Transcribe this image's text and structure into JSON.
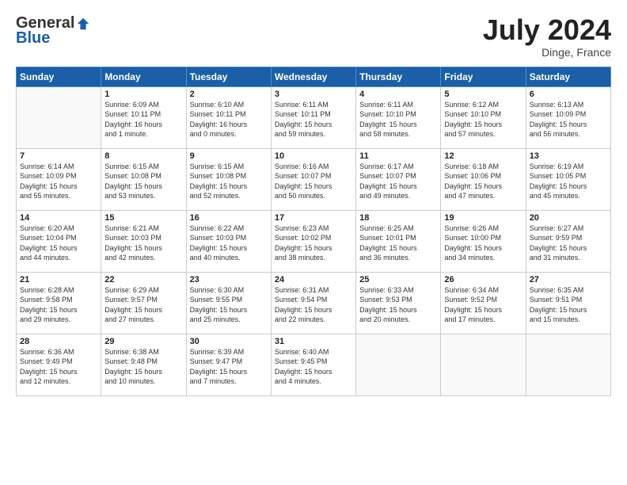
{
  "header": {
    "logo_general": "General",
    "logo_blue": "Blue",
    "month_title": "July 2024",
    "location": "Dinge, France"
  },
  "days_of_week": [
    "Sunday",
    "Monday",
    "Tuesday",
    "Wednesday",
    "Thursday",
    "Friday",
    "Saturday"
  ],
  "weeks": [
    [
      {
        "day": "",
        "info": ""
      },
      {
        "day": "1",
        "info": "Sunrise: 6:09 AM\nSunset: 10:11 PM\nDaylight: 16 hours\nand 1 minute."
      },
      {
        "day": "2",
        "info": "Sunrise: 6:10 AM\nSunset: 10:11 PM\nDaylight: 16 hours\nand 0 minutes."
      },
      {
        "day": "3",
        "info": "Sunrise: 6:11 AM\nSunset: 10:11 PM\nDaylight: 15 hours\nand 59 minutes."
      },
      {
        "day": "4",
        "info": "Sunrise: 6:11 AM\nSunset: 10:10 PM\nDaylight: 15 hours\nand 58 minutes."
      },
      {
        "day": "5",
        "info": "Sunrise: 6:12 AM\nSunset: 10:10 PM\nDaylight: 15 hours\nand 57 minutes."
      },
      {
        "day": "6",
        "info": "Sunrise: 6:13 AM\nSunset: 10:09 PM\nDaylight: 15 hours\nand 56 minutes."
      }
    ],
    [
      {
        "day": "7",
        "info": "Sunrise: 6:14 AM\nSunset: 10:09 PM\nDaylight: 15 hours\nand 55 minutes."
      },
      {
        "day": "8",
        "info": "Sunrise: 6:15 AM\nSunset: 10:08 PM\nDaylight: 15 hours\nand 53 minutes."
      },
      {
        "day": "9",
        "info": "Sunrise: 6:15 AM\nSunset: 10:08 PM\nDaylight: 15 hours\nand 52 minutes."
      },
      {
        "day": "10",
        "info": "Sunrise: 6:16 AM\nSunset: 10:07 PM\nDaylight: 15 hours\nand 50 minutes."
      },
      {
        "day": "11",
        "info": "Sunrise: 6:17 AM\nSunset: 10:07 PM\nDaylight: 15 hours\nand 49 minutes."
      },
      {
        "day": "12",
        "info": "Sunrise: 6:18 AM\nSunset: 10:06 PM\nDaylight: 15 hours\nand 47 minutes."
      },
      {
        "day": "13",
        "info": "Sunrise: 6:19 AM\nSunset: 10:05 PM\nDaylight: 15 hours\nand 45 minutes."
      }
    ],
    [
      {
        "day": "14",
        "info": "Sunrise: 6:20 AM\nSunset: 10:04 PM\nDaylight: 15 hours\nand 44 minutes."
      },
      {
        "day": "15",
        "info": "Sunrise: 6:21 AM\nSunset: 10:03 PM\nDaylight: 15 hours\nand 42 minutes."
      },
      {
        "day": "16",
        "info": "Sunrise: 6:22 AM\nSunset: 10:03 PM\nDaylight: 15 hours\nand 40 minutes."
      },
      {
        "day": "17",
        "info": "Sunrise: 6:23 AM\nSunset: 10:02 PM\nDaylight: 15 hours\nand 38 minutes."
      },
      {
        "day": "18",
        "info": "Sunrise: 6:25 AM\nSunset: 10:01 PM\nDaylight: 15 hours\nand 36 minutes."
      },
      {
        "day": "19",
        "info": "Sunrise: 6:26 AM\nSunset: 10:00 PM\nDaylight: 15 hours\nand 34 minutes."
      },
      {
        "day": "20",
        "info": "Sunrise: 6:27 AM\nSunset: 9:59 PM\nDaylight: 15 hours\nand 31 minutes."
      }
    ],
    [
      {
        "day": "21",
        "info": "Sunrise: 6:28 AM\nSunset: 9:58 PM\nDaylight: 15 hours\nand 29 minutes."
      },
      {
        "day": "22",
        "info": "Sunrise: 6:29 AM\nSunset: 9:57 PM\nDaylight: 15 hours\nand 27 minutes."
      },
      {
        "day": "23",
        "info": "Sunrise: 6:30 AM\nSunset: 9:55 PM\nDaylight: 15 hours\nand 25 minutes."
      },
      {
        "day": "24",
        "info": "Sunrise: 6:31 AM\nSunset: 9:54 PM\nDaylight: 15 hours\nand 22 minutes."
      },
      {
        "day": "25",
        "info": "Sunrise: 6:33 AM\nSunset: 9:53 PM\nDaylight: 15 hours\nand 20 minutes."
      },
      {
        "day": "26",
        "info": "Sunrise: 6:34 AM\nSunset: 9:52 PM\nDaylight: 15 hours\nand 17 minutes."
      },
      {
        "day": "27",
        "info": "Sunrise: 6:35 AM\nSunset: 9:51 PM\nDaylight: 15 hours\nand 15 minutes."
      }
    ],
    [
      {
        "day": "28",
        "info": "Sunrise: 6:36 AM\nSunset: 9:49 PM\nDaylight: 15 hours\nand 12 minutes."
      },
      {
        "day": "29",
        "info": "Sunrise: 6:38 AM\nSunset: 9:48 PM\nDaylight: 15 hours\nand 10 minutes."
      },
      {
        "day": "30",
        "info": "Sunrise: 6:39 AM\nSunset: 9:47 PM\nDaylight: 15 hours\nand 7 minutes."
      },
      {
        "day": "31",
        "info": "Sunrise: 6:40 AM\nSunset: 9:45 PM\nDaylight: 15 hours\nand 4 minutes."
      },
      {
        "day": "",
        "info": ""
      },
      {
        "day": "",
        "info": ""
      },
      {
        "day": "",
        "info": ""
      }
    ]
  ]
}
